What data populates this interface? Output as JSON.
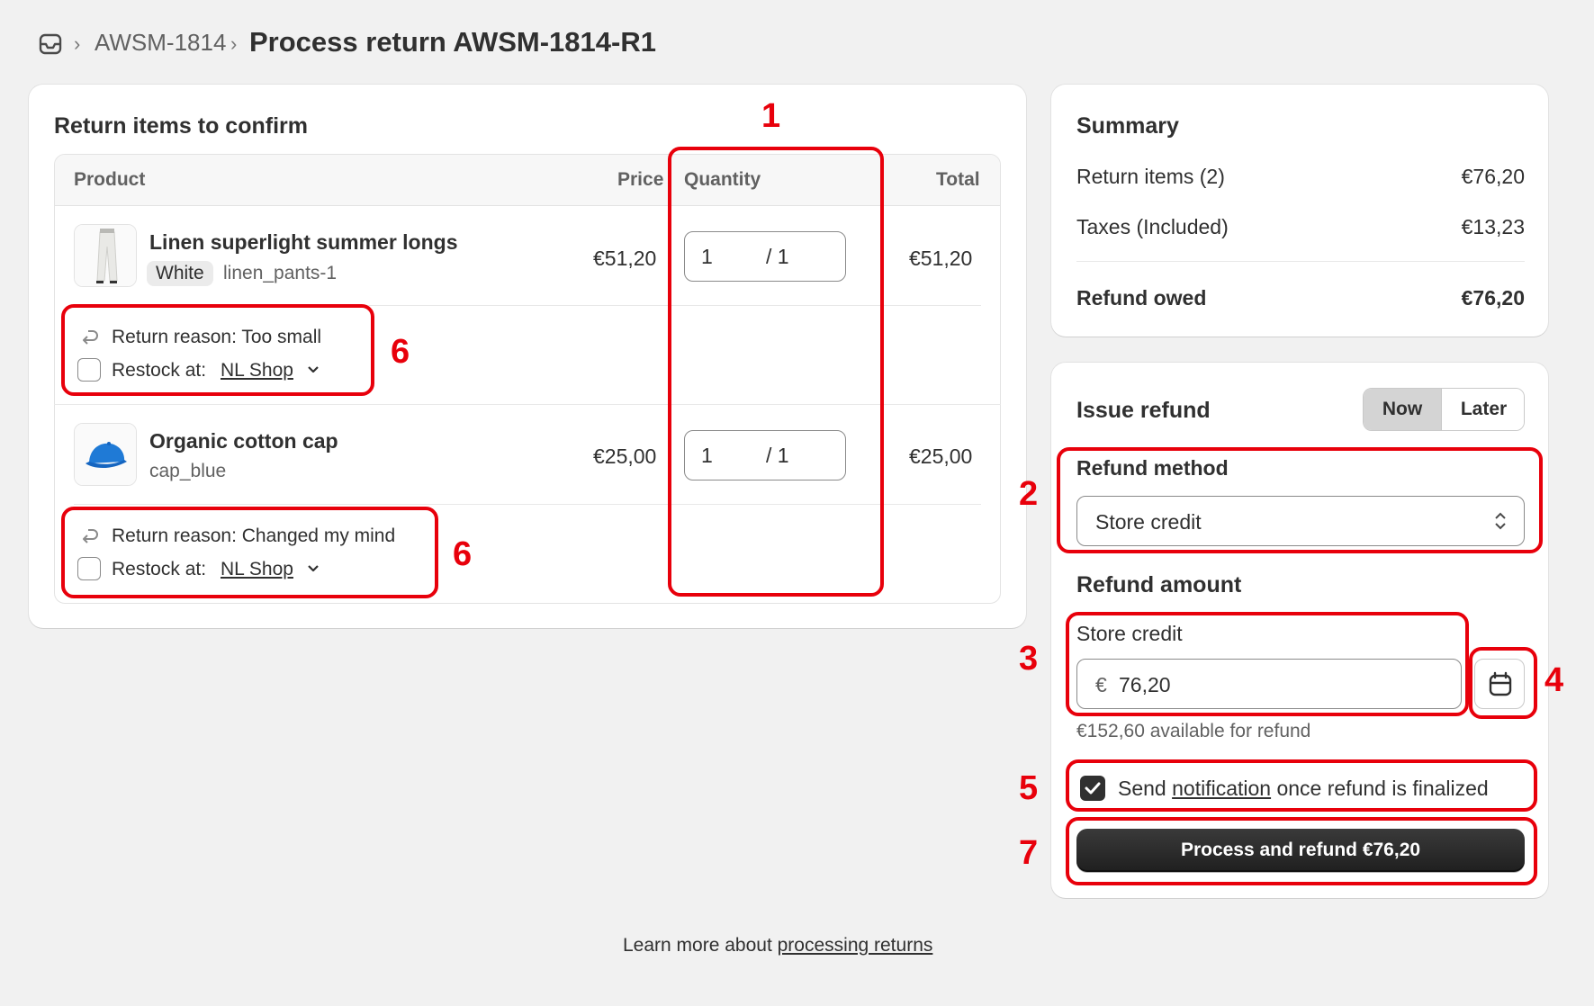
{
  "breadcrumb": {
    "parent": "AWSM-1814",
    "separator": "›",
    "title": "Process return AWSM-1814-R1"
  },
  "items_card": {
    "title": "Return items to confirm",
    "columns": {
      "product": "Product",
      "price": "Price",
      "quantity": "Quantity",
      "total": "Total"
    },
    "items": [
      {
        "name": "Linen superlight summer longs",
        "variant": "White",
        "sku": "linen_pants-1",
        "price": "€51,20",
        "qty_value": "1",
        "qty_max": "/ 1",
        "total": "€51,20",
        "reason": "Return reason: Too small",
        "restock_label": "Restock at:",
        "restock_location": "NL Shop"
      },
      {
        "name": "Organic cotton cap",
        "variant": "",
        "sku": "cap_blue",
        "price": "€25,00",
        "qty_value": "1",
        "qty_max": "/ 1",
        "total": "€25,00",
        "reason": "Return reason: Changed my mind",
        "restock_label": "Restock at:",
        "restock_location": "NL Shop"
      }
    ]
  },
  "summary": {
    "title": "Summary",
    "rows": [
      {
        "label": "Return items (2)",
        "value": "€76,20"
      },
      {
        "label": "Taxes (Included)",
        "value": "€13,23"
      }
    ],
    "total_label": "Refund owed",
    "total_value": "€76,20"
  },
  "refund": {
    "title": "Issue refund",
    "toggle_now": "Now",
    "toggle_later": "Later",
    "method_label": "Refund method",
    "method_value": "Store credit",
    "amount_title": "Refund amount",
    "credit_label": "Store credit",
    "currency_symbol": "€",
    "credit_value": "76,20",
    "available_text": "€152,60 available for refund",
    "notify_prefix": "Send",
    "notify_link": "notification",
    "notify_suffix": "once refund is finalized",
    "submit_label": "Process and refund €76,20"
  },
  "footer": {
    "prefix": "Learn more about",
    "link": "processing returns"
  },
  "annotations": {
    "n1": "1",
    "n2": "2",
    "n3": "3",
    "n4": "4",
    "n5": "5",
    "n6": "6",
    "n7": "7",
    "color": "#e8000b"
  }
}
